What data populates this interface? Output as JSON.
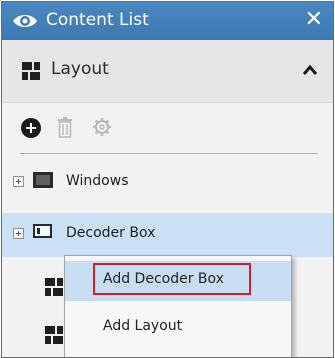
{
  "panel": {
    "title": "Content List",
    "close_glyph": "✕",
    "icons": [
      "eye-icon",
      "close-icon"
    ]
  },
  "layout_section": {
    "label": "Layout",
    "icons": [
      "grid-icon",
      "chevron-up-icon"
    ]
  },
  "toolbar": {
    "icons": [
      "add-circle-icon",
      "trash-icon",
      "gear-icon"
    ]
  },
  "tree": {
    "items": [
      {
        "label": "Windows",
        "icon": "windows-icon"
      },
      {
        "label": "Decoder Box",
        "icon": "decoder-box-icon",
        "selected": true
      }
    ]
  },
  "context_menu": {
    "items": [
      {
        "label": "Add Decoder Box",
        "highlighted": true
      },
      {
        "label": "Add Layout"
      }
    ]
  },
  "colors": {
    "title_bar": "#3f7bb5",
    "selection": "#c9e0f5",
    "menu_highlight": "#c7ddf1",
    "annotation_box": "#d41c2c"
  }
}
